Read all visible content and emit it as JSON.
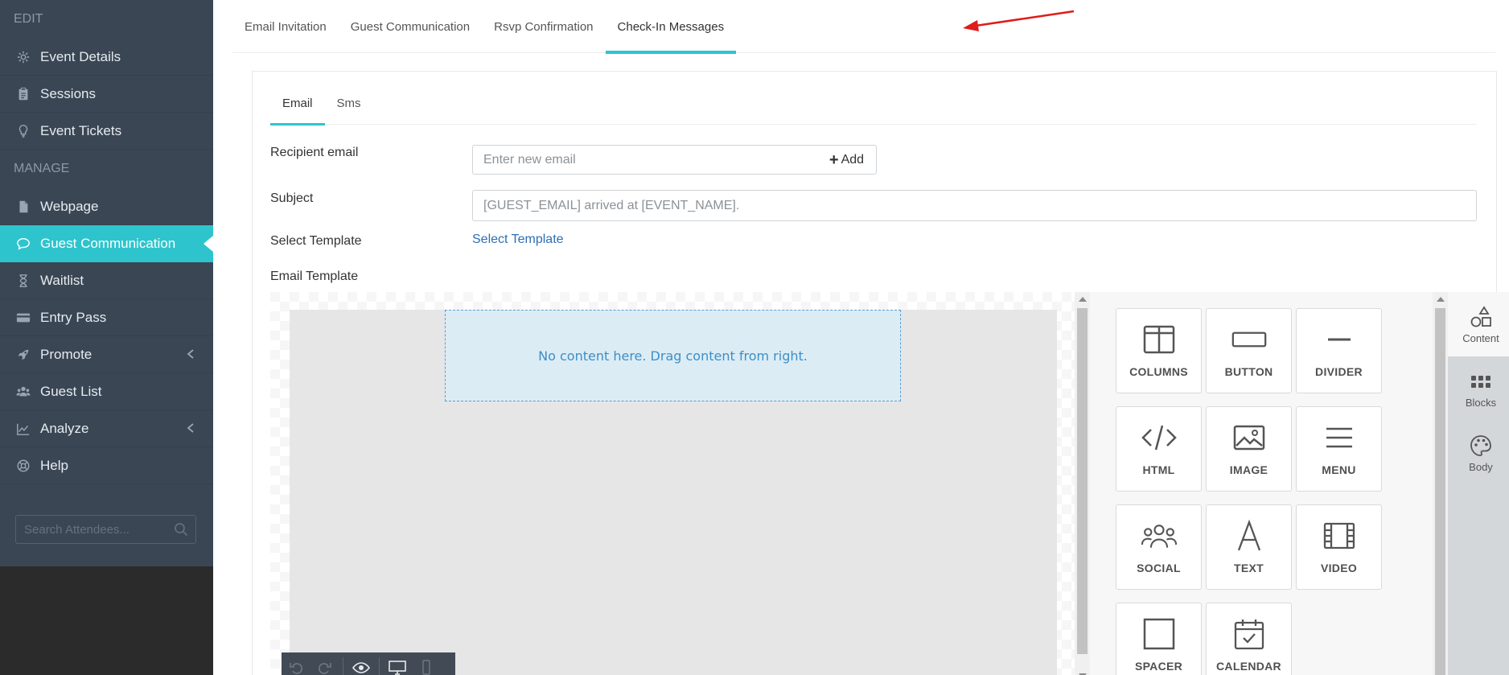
{
  "sidebar": {
    "sections": {
      "edit": "EDIT",
      "manage": "MANAGE"
    },
    "items": [
      {
        "label": "Event Details",
        "icon": "gear-icon"
      },
      {
        "label": "Sessions",
        "icon": "clipboard-icon"
      },
      {
        "label": "Event Tickets",
        "icon": "lightbulb-icon"
      },
      {
        "label": "Webpage",
        "icon": "file-icon"
      },
      {
        "label": "Guest Communication",
        "icon": "chat-icon",
        "active": true
      },
      {
        "label": "Waitlist",
        "icon": "hourglass-icon"
      },
      {
        "label": "Entry Pass",
        "icon": "card-icon"
      },
      {
        "label": "Promote",
        "icon": "rocket-icon"
      },
      {
        "label": "Guest List",
        "icon": "users-icon"
      },
      {
        "label": "Analyze",
        "icon": "chart-icon"
      },
      {
        "label": "Help",
        "icon": "lifebuoy-icon"
      }
    ],
    "search_placeholder": "Search Attendees..."
  },
  "top_tabs": [
    "Email Invitation",
    "Guest Communication",
    "Rsvp Confirmation",
    "Check-In Messages"
  ],
  "active_top_tab": "Check-In Messages",
  "sub_tabs": [
    "Email",
    "Sms"
  ],
  "active_sub_tab": "Email",
  "form": {
    "recipient_label": "Recipient email",
    "recipient_placeholder": "Enter new email",
    "add_label": "Add",
    "subject_label": "Subject",
    "subject_placeholder": "[GUEST_EMAIL] arrived at [EVENT_NAME].",
    "template_label": "Select Template",
    "template_link": "Select Template",
    "email_template_label": "Email Template"
  },
  "editor": {
    "empty_message": "No content here. Drag content from right.",
    "toolbar": [
      "undo-icon",
      "redo-icon",
      "eye-icon",
      "desktop-icon",
      "mobile-icon"
    ],
    "tiles": [
      "COLUMNS",
      "BUTTON",
      "DIVIDER",
      "HTML",
      "IMAGE",
      "MENU",
      "SOCIAL",
      "TEXT",
      "VIDEO",
      "SPACER",
      "CALENDAR"
    ],
    "side_tabs": [
      "Content",
      "Blocks",
      "Body"
    ],
    "active_side_tab": "Content"
  },
  "colors": {
    "accent": "#2ec4cd",
    "sidebar": "#3a4654",
    "link": "#2e6fb5",
    "annotation_arrow": "#e01b1b"
  }
}
